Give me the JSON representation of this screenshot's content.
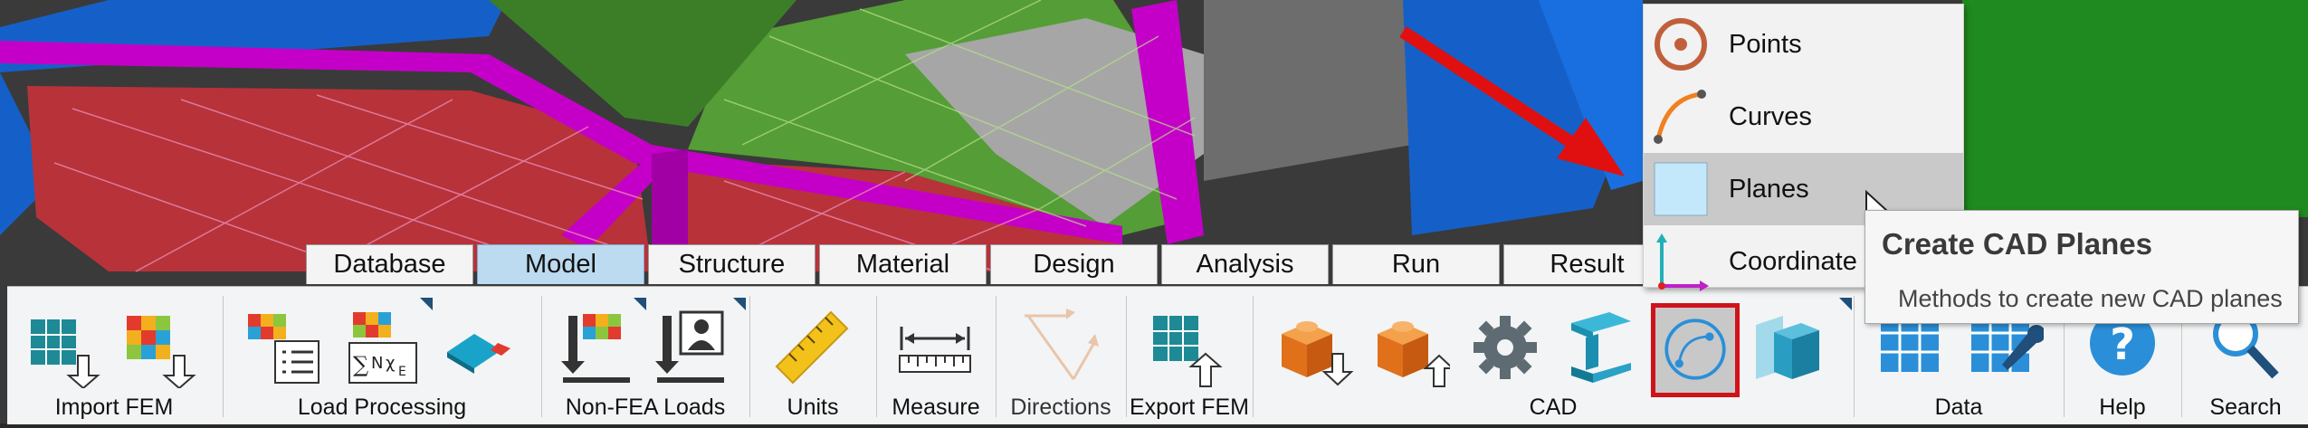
{
  "tabs": [
    {
      "label": "Database"
    },
    {
      "label": "Model",
      "active": true
    },
    {
      "label": "Structure"
    },
    {
      "label": "Material"
    },
    {
      "label": "Design"
    },
    {
      "label": "Analysis"
    },
    {
      "label": "Run"
    },
    {
      "label": "Result"
    }
  ],
  "ribbon": {
    "groups": [
      {
        "label": "Import FEM"
      },
      {
        "label": "Load Processing"
      },
      {
        "label": "Non-FEA Loads"
      },
      {
        "label": "Units"
      },
      {
        "label": "Measure"
      },
      {
        "label": "Directions"
      },
      {
        "label": "Export FEM"
      },
      {
        "label": "CAD"
      },
      {
        "label": "Data"
      },
      {
        "label": "Help"
      },
      {
        "label": "Search"
      }
    ]
  },
  "cad_menu": {
    "items": [
      {
        "label": "Points",
        "icon": "point-target-icon"
      },
      {
        "label": "Curves",
        "icon": "curve-icon"
      },
      {
        "label": "Planes",
        "icon": "plane-icon",
        "hovered": true
      },
      {
        "label": "Coordinate",
        "icon": "coordinate-axes-icon"
      }
    ]
  },
  "tooltip": {
    "title": "Create CAD Planes",
    "description": "Methods to create new CAD planes"
  },
  "colors": {
    "ribbon_bg": "#f3f4f5",
    "active_tab": "#bcdaf0",
    "highlight_border": "#d0121b",
    "annotation_arrow": "#e01010",
    "mesh_magenta": "#c400c8",
    "mesh_green": "#4f9a2f",
    "mesh_red": "#b8323a",
    "mesh_blue": "#1560c8"
  }
}
